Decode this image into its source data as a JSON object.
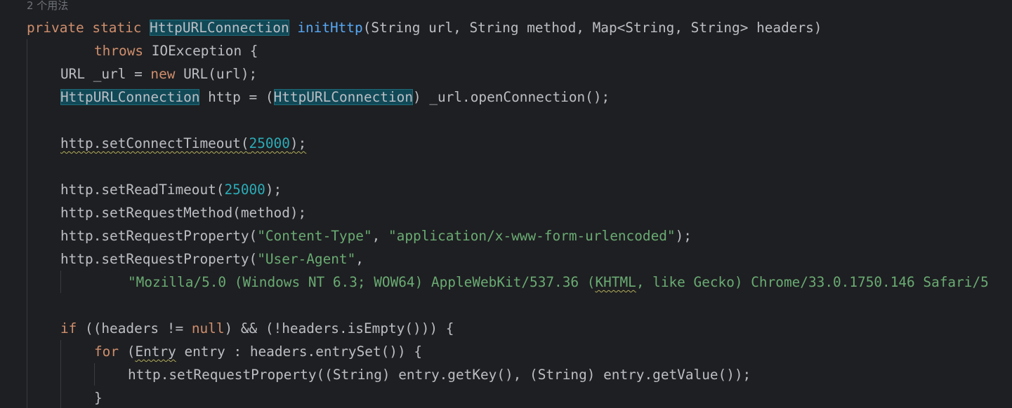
{
  "usage_hint": "2 个用法",
  "code": {
    "l1": {
      "kw1": "private",
      "kw2": "static",
      "ret_type": "HttpURLConnection",
      "method_name": "initHttp",
      "params": "(String url, String method, Map<String, String> headers)"
    },
    "l2": {
      "kw": "throws",
      "rest": " IOException {"
    },
    "l3": {
      "pre": "URL _url = ",
      "kw": "new",
      "post": " URL(url);"
    },
    "l4": {
      "type1": "HttpURLConnection",
      "mid": " http = (",
      "type2": "HttpURLConnection",
      "post": ") _url.openConnection();"
    },
    "l6": {
      "pre": "http.setConnectTimeout(",
      "num": "25000",
      "post": ");"
    },
    "l8": {
      "pre": "http.setReadTimeout(",
      "num": "25000",
      "post": ");"
    },
    "l9": {
      "text": "http.setRequestMethod(method);"
    },
    "l10": {
      "pre": "http.setRequestProperty(",
      "str1": "\"Content-Type\"",
      "mid": ", ",
      "str2": "\"application/x-www-form-urlencoded\"",
      "post": ");"
    },
    "l11": {
      "pre": "http.setRequestProperty(",
      "str1": "\"User-Agent\"",
      "post": ","
    },
    "l12": {
      "str_a": "\"Mozilla/5.0 (Windows NT 6.3; WOW64) AppleWebKit/537.36 (",
      "str_warn": "KHTML",
      "str_b": ", like Gecko) Chrome/33.0.1750.146 Safari/5"
    },
    "l14": {
      "kw1": "if",
      "mid": " ((headers != ",
      "kw2": "null",
      "post": ") && (!headers.isEmpty())) {"
    },
    "l15": {
      "kw": "for",
      "mid": " (",
      "warn": "Entry",
      "post": " entry : headers.entrySet()) {"
    },
    "l16": {
      "text": "http.setRequestProperty((String) entry.getKey(), (String) entry.getValue());"
    },
    "l17": {
      "text": "}"
    }
  },
  "colors": {
    "background": "#1e1f22",
    "default_text": "#bcbec4",
    "keyword": "#cf8e6d",
    "function": "#56a8f5",
    "number": "#2aacb8",
    "string": "#6aab73",
    "highlight_bg": "#114957",
    "warning_underline": "#b3ad5b"
  }
}
